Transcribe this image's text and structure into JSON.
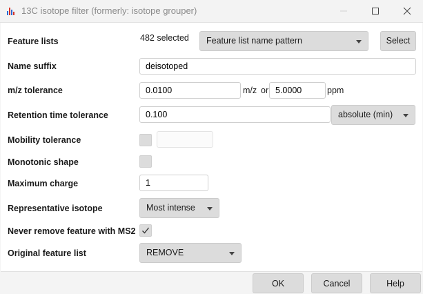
{
  "window": {
    "title": "13C isotope filter (formerly: isotope grouper)",
    "icon": "chart-app-icon",
    "controls": [
      "minimize-icon",
      "maximize-icon",
      "close-icon"
    ]
  },
  "form": {
    "feature_lists": {
      "label": "Feature lists",
      "value": "482 selected",
      "mode": "Feature list name pattern",
      "button": "Select"
    },
    "name_suffix": {
      "label": "Name suffix",
      "value": "deisotoped"
    },
    "mz_tolerance": {
      "label": "m/z tolerance",
      "mz_value": "0.0100",
      "mz_unit": "m/z",
      "or": "or",
      "ppm_value": "5.0000",
      "ppm_unit": "ppm"
    },
    "rt_tolerance": {
      "label": "Retention time tolerance",
      "value": "0.100",
      "unit": "absolute (min)"
    },
    "mobility_tolerance": {
      "label": "Mobility tolerance",
      "checked": false,
      "value": ""
    },
    "monotonic_shape": {
      "label": "Monotonic shape",
      "checked": false
    },
    "maximum_charge": {
      "label": "Maximum charge",
      "value": "1"
    },
    "representative_isotope": {
      "label": "Representative isotope",
      "value": "Most intense"
    },
    "never_remove_ms2": {
      "label": "Never remove feature with MS2",
      "checked": true
    },
    "original_feature_list": {
      "label": "Original feature list",
      "value": "REMOVE"
    }
  },
  "footer": {
    "ok": "OK",
    "cancel": "Cancel",
    "help": "Help"
  },
  "colors": {
    "accent_red": "#d9352a",
    "accent_blue": "#2b6cd6",
    "button_bg": "#dcdcdc"
  }
}
